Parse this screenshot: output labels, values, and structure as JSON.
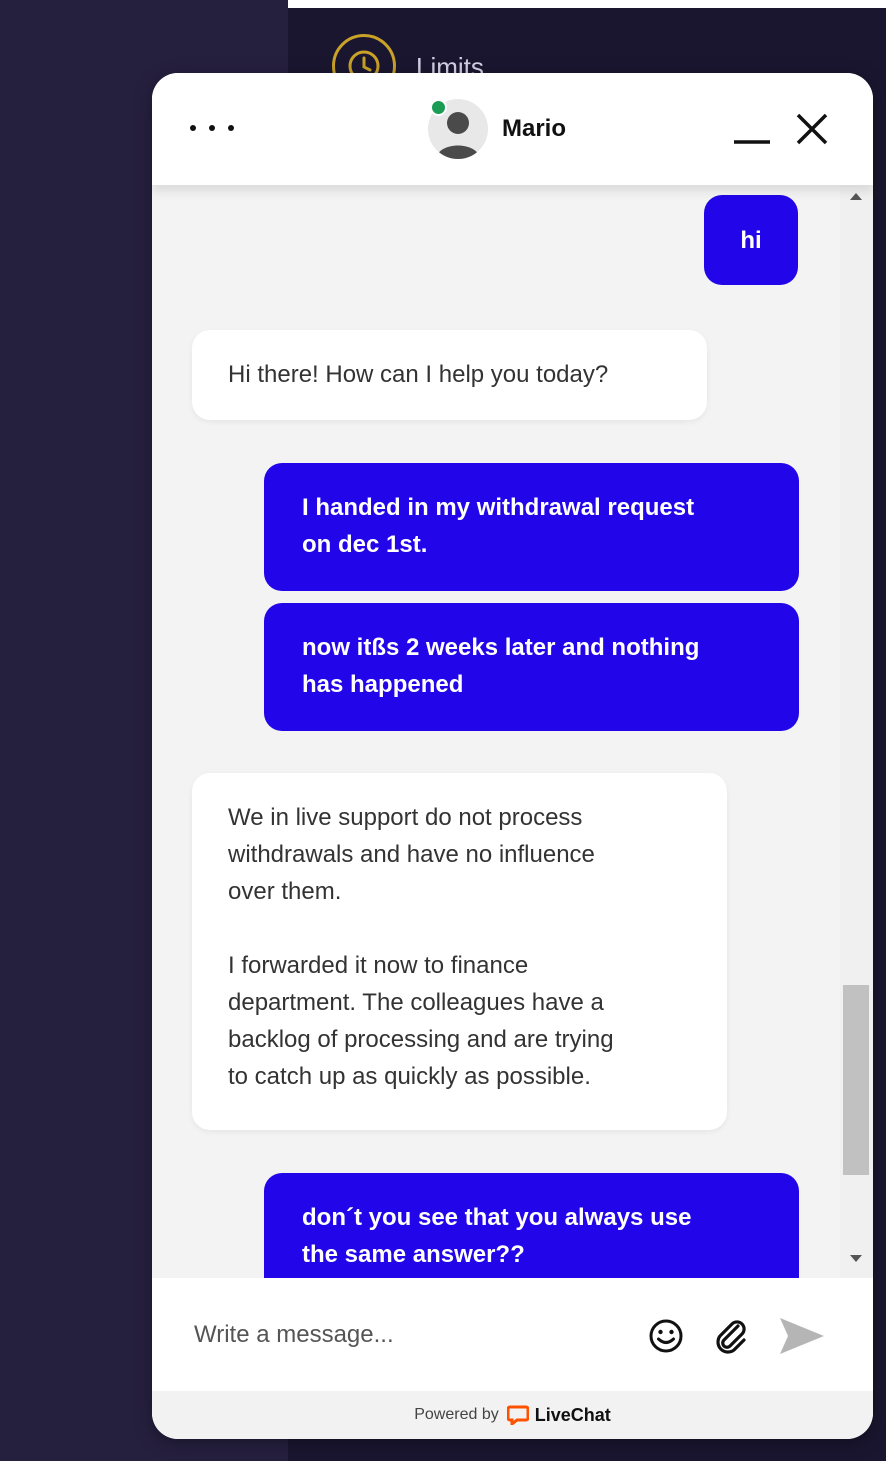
{
  "background": {
    "limits_label": "Limits",
    "accent": "#c9a227"
  },
  "chat": {
    "agent_name": "Mario",
    "agent_status": "online",
    "accent_color": "#2205e8",
    "messages": [
      {
        "from": "visitor",
        "text": "hi"
      },
      {
        "from": "agent",
        "text": "Hi there! How can I help you today?"
      },
      {
        "from": "visitor",
        "text": "I handed in my withdrawal request\non dec 1st."
      },
      {
        "from": "visitor",
        "text": "now itßs 2 weeks later and nothing\nhas happened"
      },
      {
        "from": "agent",
        "text": "We in live support do not process\nwithdrawals and have no influence\nover them.\n\nI forwarded it now to finance\ndepartment. The colleagues have a\nbacklog of processing and are trying\nto catch up as quickly as possible."
      },
      {
        "from": "visitor",
        "text": "don´t you see that you always use\nthe same answer??"
      }
    ],
    "composer_placeholder": "Write a message...",
    "icons": {
      "more": "more-dots-icon",
      "minimize": "minimize-icon",
      "close": "close-icon",
      "emoji": "emoji-icon",
      "attach": "paperclip-icon",
      "send": "send-icon"
    }
  },
  "footer": {
    "powered_by": "Powered by",
    "brand": "LiveChat",
    "brand_color": "#ff5100"
  }
}
